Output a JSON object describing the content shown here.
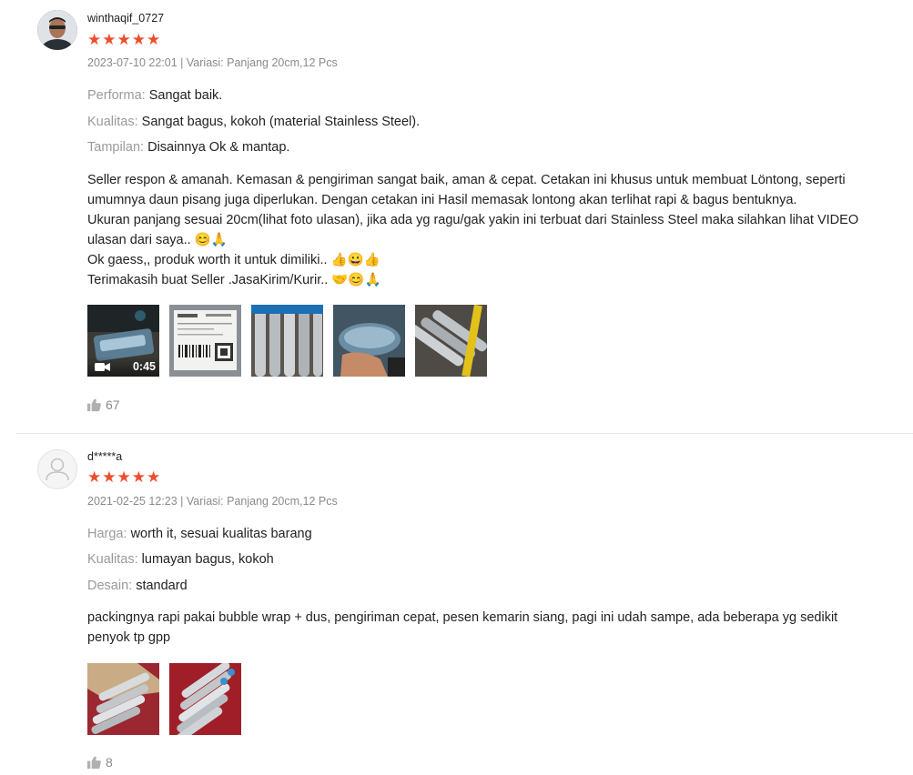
{
  "reviews": [
    {
      "username": "winthaqif_0727",
      "stars": "★★★★★",
      "meta": "2023-07-10 22:01 | Variasi: Panjang 20cm,12 Pcs",
      "attributes": [
        {
          "label": "Performa:",
          "value": "Sangat baik."
        },
        {
          "label": "Kualitas:",
          "value": "Sangat bagus, kokoh (material Stainless Steel)."
        },
        {
          "label": "Tampilan:",
          "value": "Disainnya Ok & mantap."
        }
      ],
      "body_lines": [
        "Seller respon & amanah. Kemasan & pengiriman sangat baik, aman & cepat. Cetakan ini khusus untuk membuat Löntong, seperti",
        "umumnya daun pisang juga diperlukan. Dengan cetakan ini Hasil memasak lontong akan terlihat rapi & bagus bentuknya.",
        "Ukuran panjang sesuai 20cm(lihat foto ulasan), jika ada yg ragu/gak yakin ini terbuat dari Stainless Steel maka silahkan lihat VIDEO",
        "ulasan dari saya.. 😊🙏",
        "Ok gaess,, produk worth it untuk dimiliki.. 👍😀👍",
        "Terimakasih buat Seller              .JasaKirim/Kurir.. 🤝😊🙏"
      ],
      "video_duration": "0:45",
      "likes": "67"
    },
    {
      "username": "d*****a",
      "stars": "★★★★★",
      "meta": "2021-02-25 12:23 | Variasi: Panjang 20cm,12 Pcs",
      "attributes": [
        {
          "label": "Harga:",
          "value": "worth it, sesuai kualitas barang"
        },
        {
          "label": "Kualitas:",
          "value": "lumayan bagus, kokoh"
        },
        {
          "label": "Desain:",
          "value": "standard"
        }
      ],
      "body_lines": [
        "packingnya rapi pakai bubble wrap + dus, pengiriman cepat, pesen kemarin siang, pagi ini udah sampe, ada beberapa yg sedikit",
        "penyok tp gpp"
      ],
      "likes": "8"
    }
  ]
}
